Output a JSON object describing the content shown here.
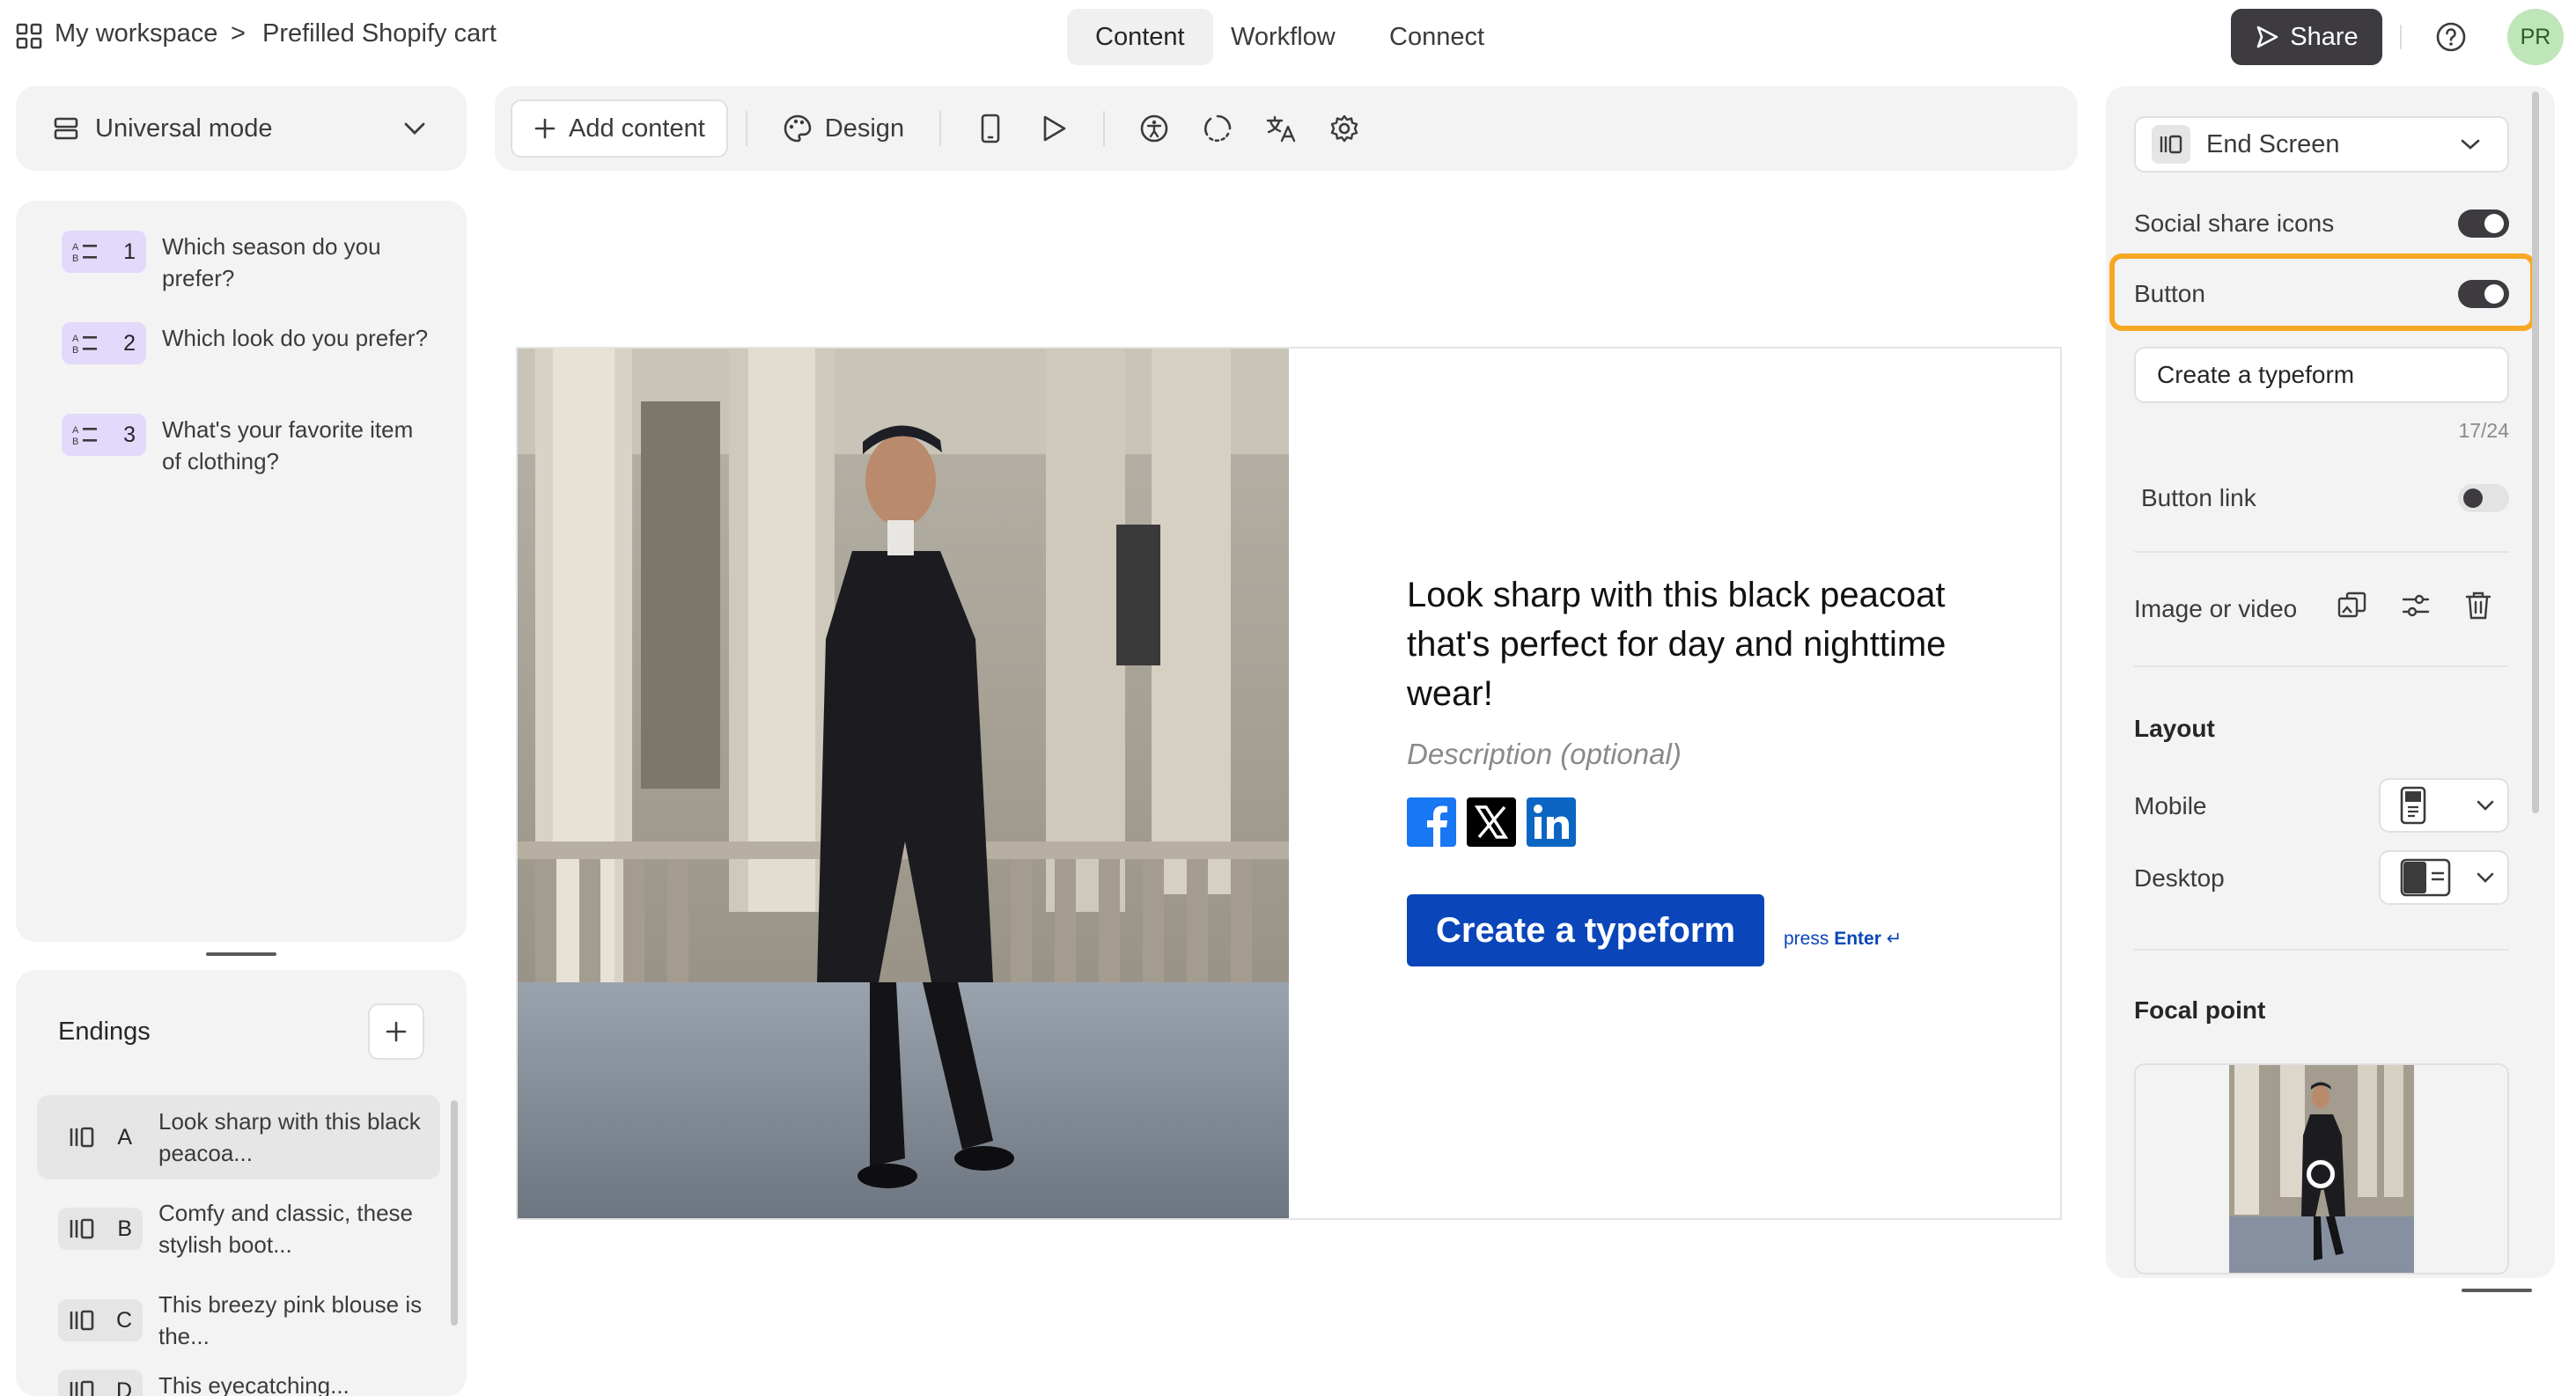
{
  "breadcrumb": {
    "workspace": "My workspace",
    "separator": ">",
    "form_name": "Prefilled Shopify cart"
  },
  "nav_tabs": [
    {
      "label": "Content",
      "active": true
    },
    {
      "label": "Workflow",
      "active": false
    },
    {
      "label": "Connect",
      "active": false
    }
  ],
  "header": {
    "share_label": "Share",
    "help_icon": "question-circle-icon",
    "avatar_initials": "PR"
  },
  "mode_selector": {
    "label": "Universal mode"
  },
  "questions": [
    {
      "number": "1",
      "text": "Which season do you prefer?"
    },
    {
      "number": "2",
      "text": "Which look do you prefer?"
    },
    {
      "number": "3",
      "text": "What's your favorite item of clothing?"
    }
  ],
  "endings": {
    "title": "Endings",
    "items": [
      {
        "letter": "A",
        "text": "Look sharp with this black peacoa...",
        "selected": true
      },
      {
        "letter": "B",
        "text": "Comfy and classic, these stylish boot...",
        "selected": false
      },
      {
        "letter": "C",
        "text": "This breezy pink blouse is the...",
        "selected": false
      },
      {
        "letter": "D",
        "text": "This eyecatching...",
        "selected": false
      }
    ]
  },
  "toolbar": {
    "add_content_label": "Add content",
    "design_label": "Design",
    "icons": [
      "mobile-preview-icon",
      "play-icon",
      "accessibility-icon",
      "loading-icon",
      "translate-icon",
      "settings-icon"
    ]
  },
  "canvas": {
    "heading": "Look sharp with this black peacoat that's perfect for day and nighttime wear!",
    "description_placeholder": "Description (optional)",
    "social_icons": [
      "facebook-icon",
      "x-icon",
      "linkedin-icon"
    ],
    "button_label": "Create a typeform",
    "press_hint": "press",
    "press_key": "Enter",
    "enter_symbol": "↵"
  },
  "settings": {
    "screen_selector": "End Screen",
    "social_share_label": "Social share icons",
    "social_share_on": true,
    "button_label": "Button",
    "button_on": true,
    "button_text_value": "Create a typeform",
    "char_count": "17/24",
    "button_link_label": "Button link",
    "button_link_on": false,
    "image_or_video_label": "Image or video",
    "layout_title": "Layout",
    "mobile_label": "Mobile",
    "desktop_label": "Desktop",
    "focal_point_title": "Focal point"
  },
  "colors": {
    "accent_button": "#0a46b9",
    "highlight_outline": "#f6a823",
    "question_badge": "#e2d9fb",
    "dark": "#3d3a40"
  }
}
